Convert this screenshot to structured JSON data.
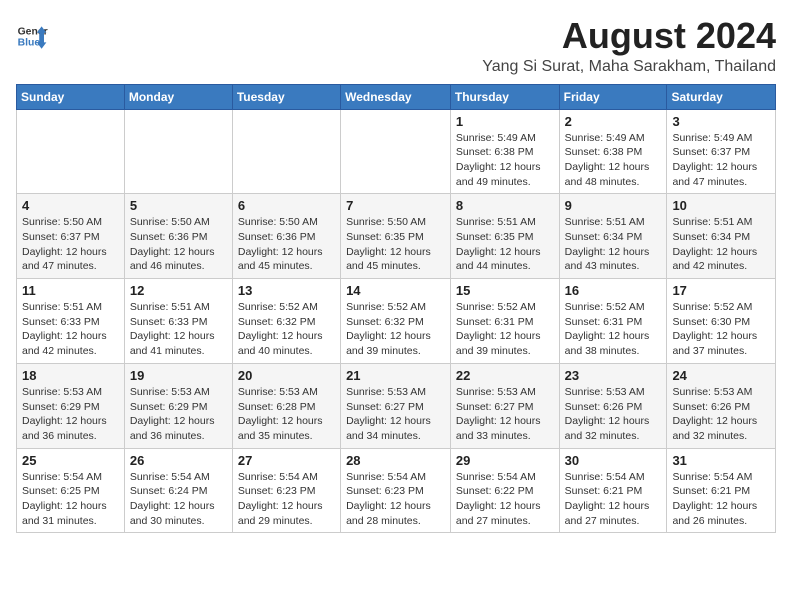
{
  "header": {
    "logo_line1": "General",
    "logo_line2": "Blue",
    "main_title": "August 2024",
    "subtitle": "Yang Si Surat, Maha Sarakham, Thailand"
  },
  "weekdays": [
    "Sunday",
    "Monday",
    "Tuesday",
    "Wednesday",
    "Thursday",
    "Friday",
    "Saturday"
  ],
  "weeks": [
    [
      {
        "day": "",
        "text": ""
      },
      {
        "day": "",
        "text": ""
      },
      {
        "day": "",
        "text": ""
      },
      {
        "day": "",
        "text": ""
      },
      {
        "day": "1",
        "text": "Sunrise: 5:49 AM\nSunset: 6:38 PM\nDaylight: 12 hours\nand 49 minutes."
      },
      {
        "day": "2",
        "text": "Sunrise: 5:49 AM\nSunset: 6:38 PM\nDaylight: 12 hours\nand 48 minutes."
      },
      {
        "day": "3",
        "text": "Sunrise: 5:49 AM\nSunset: 6:37 PM\nDaylight: 12 hours\nand 47 minutes."
      }
    ],
    [
      {
        "day": "4",
        "text": "Sunrise: 5:50 AM\nSunset: 6:37 PM\nDaylight: 12 hours\nand 47 minutes."
      },
      {
        "day": "5",
        "text": "Sunrise: 5:50 AM\nSunset: 6:36 PM\nDaylight: 12 hours\nand 46 minutes."
      },
      {
        "day": "6",
        "text": "Sunrise: 5:50 AM\nSunset: 6:36 PM\nDaylight: 12 hours\nand 45 minutes."
      },
      {
        "day": "7",
        "text": "Sunrise: 5:50 AM\nSunset: 6:35 PM\nDaylight: 12 hours\nand 45 minutes."
      },
      {
        "day": "8",
        "text": "Sunrise: 5:51 AM\nSunset: 6:35 PM\nDaylight: 12 hours\nand 44 minutes."
      },
      {
        "day": "9",
        "text": "Sunrise: 5:51 AM\nSunset: 6:34 PM\nDaylight: 12 hours\nand 43 minutes."
      },
      {
        "day": "10",
        "text": "Sunrise: 5:51 AM\nSunset: 6:34 PM\nDaylight: 12 hours\nand 42 minutes."
      }
    ],
    [
      {
        "day": "11",
        "text": "Sunrise: 5:51 AM\nSunset: 6:33 PM\nDaylight: 12 hours\nand 42 minutes."
      },
      {
        "day": "12",
        "text": "Sunrise: 5:51 AM\nSunset: 6:33 PM\nDaylight: 12 hours\nand 41 minutes."
      },
      {
        "day": "13",
        "text": "Sunrise: 5:52 AM\nSunset: 6:32 PM\nDaylight: 12 hours\nand 40 minutes."
      },
      {
        "day": "14",
        "text": "Sunrise: 5:52 AM\nSunset: 6:32 PM\nDaylight: 12 hours\nand 39 minutes."
      },
      {
        "day": "15",
        "text": "Sunrise: 5:52 AM\nSunset: 6:31 PM\nDaylight: 12 hours\nand 39 minutes."
      },
      {
        "day": "16",
        "text": "Sunrise: 5:52 AM\nSunset: 6:31 PM\nDaylight: 12 hours\nand 38 minutes."
      },
      {
        "day": "17",
        "text": "Sunrise: 5:52 AM\nSunset: 6:30 PM\nDaylight: 12 hours\nand 37 minutes."
      }
    ],
    [
      {
        "day": "18",
        "text": "Sunrise: 5:53 AM\nSunset: 6:29 PM\nDaylight: 12 hours\nand 36 minutes."
      },
      {
        "day": "19",
        "text": "Sunrise: 5:53 AM\nSunset: 6:29 PM\nDaylight: 12 hours\nand 36 minutes."
      },
      {
        "day": "20",
        "text": "Sunrise: 5:53 AM\nSunset: 6:28 PM\nDaylight: 12 hours\nand 35 minutes."
      },
      {
        "day": "21",
        "text": "Sunrise: 5:53 AM\nSunset: 6:27 PM\nDaylight: 12 hours\nand 34 minutes."
      },
      {
        "day": "22",
        "text": "Sunrise: 5:53 AM\nSunset: 6:27 PM\nDaylight: 12 hours\nand 33 minutes."
      },
      {
        "day": "23",
        "text": "Sunrise: 5:53 AM\nSunset: 6:26 PM\nDaylight: 12 hours\nand 32 minutes."
      },
      {
        "day": "24",
        "text": "Sunrise: 5:53 AM\nSunset: 6:26 PM\nDaylight: 12 hours\nand 32 minutes."
      }
    ],
    [
      {
        "day": "25",
        "text": "Sunrise: 5:54 AM\nSunset: 6:25 PM\nDaylight: 12 hours\nand 31 minutes."
      },
      {
        "day": "26",
        "text": "Sunrise: 5:54 AM\nSunset: 6:24 PM\nDaylight: 12 hours\nand 30 minutes."
      },
      {
        "day": "27",
        "text": "Sunrise: 5:54 AM\nSunset: 6:23 PM\nDaylight: 12 hours\nand 29 minutes."
      },
      {
        "day": "28",
        "text": "Sunrise: 5:54 AM\nSunset: 6:23 PM\nDaylight: 12 hours\nand 28 minutes."
      },
      {
        "day": "29",
        "text": "Sunrise: 5:54 AM\nSunset: 6:22 PM\nDaylight: 12 hours\nand 27 minutes."
      },
      {
        "day": "30",
        "text": "Sunrise: 5:54 AM\nSunset: 6:21 PM\nDaylight: 12 hours\nand 27 minutes."
      },
      {
        "day": "31",
        "text": "Sunrise: 5:54 AM\nSunset: 6:21 PM\nDaylight: 12 hours\nand 26 minutes."
      }
    ]
  ]
}
